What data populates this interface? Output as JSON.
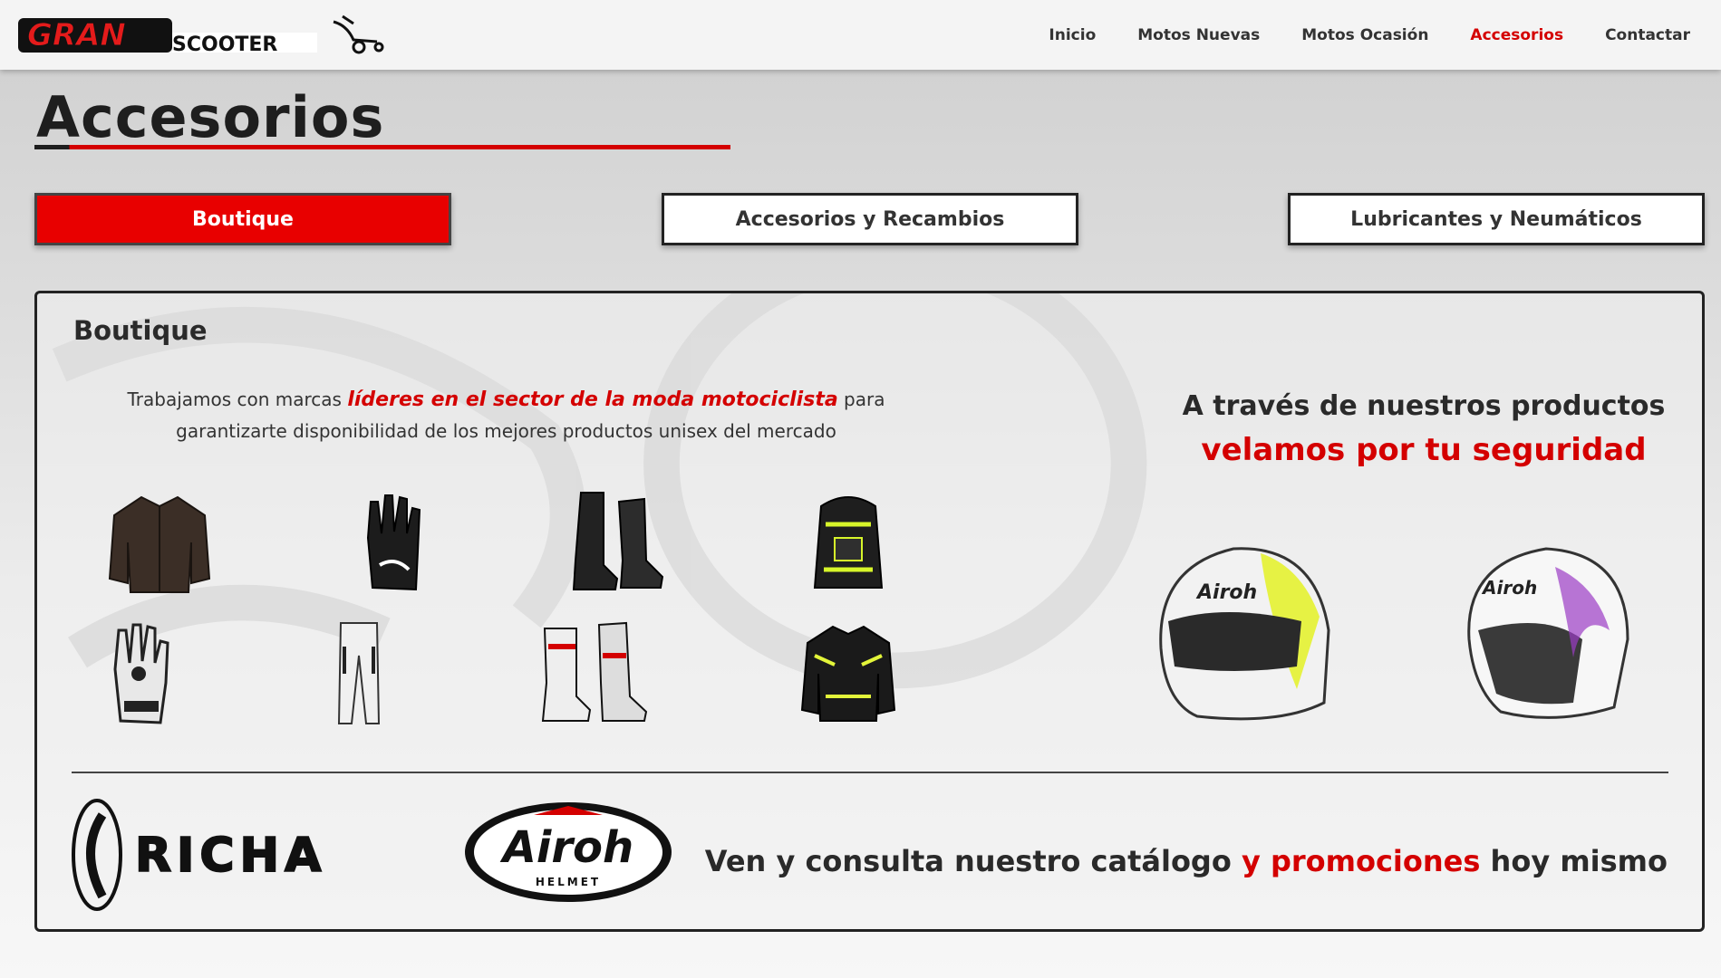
{
  "header": {
    "logo_text_1": "GRAN",
    "logo_text_2": "SCOOTER",
    "nav": [
      {
        "label": "Inicio",
        "active": false
      },
      {
        "label": "Motos Nuevas",
        "active": false
      },
      {
        "label": "Motos Ocasión",
        "active": false
      },
      {
        "label": "Accesorios",
        "active": true
      },
      {
        "label": "Contactar",
        "active": false
      }
    ]
  },
  "page": {
    "title": "Accesorios"
  },
  "tabs": [
    {
      "label": "Boutique",
      "active": true
    },
    {
      "label": "Accesorios y Recambios",
      "active": false
    },
    {
      "label": "Lubricantes y Neumáticos",
      "active": false
    }
  ],
  "boutique": {
    "heading": "Boutique",
    "intro_before": "Trabajamos con marcas ",
    "intro_highlight": "líderes en el sector de la moda motociclista",
    "intro_after": " para garantizarte disponibilidad de los mejores productos unisex del mercado",
    "products": [
      {
        "icon": "leather-jacket-icon"
      },
      {
        "icon": "glove-icon"
      },
      {
        "icon": "boots-icon"
      },
      {
        "icon": "backpack-icon"
      },
      {
        "icon": "racing-glove-icon"
      },
      {
        "icon": "pants-icon"
      },
      {
        "icon": "racing-boot-icon"
      },
      {
        "icon": "textile-jacket-icon"
      }
    ],
    "tagline_1": "A través de nuestros productos",
    "tagline_2": "velamos por tu seguridad",
    "helmets": [
      {
        "icon": "full-face-helmet-icon"
      },
      {
        "icon": "open-face-helmet-icon"
      }
    ],
    "brands": [
      {
        "name": "RICHA"
      },
      {
        "name": "Airoh",
        "sub": "HELMET"
      }
    ],
    "cta_1": "Ven y consulta nuestro catálogo ",
    "cta_2": "y promociones",
    "cta_3": " hoy mismo"
  },
  "colors": {
    "accent": "#d40000",
    "tab_active_bg": "#e80000",
    "text_dark": "#2a2a2a"
  }
}
